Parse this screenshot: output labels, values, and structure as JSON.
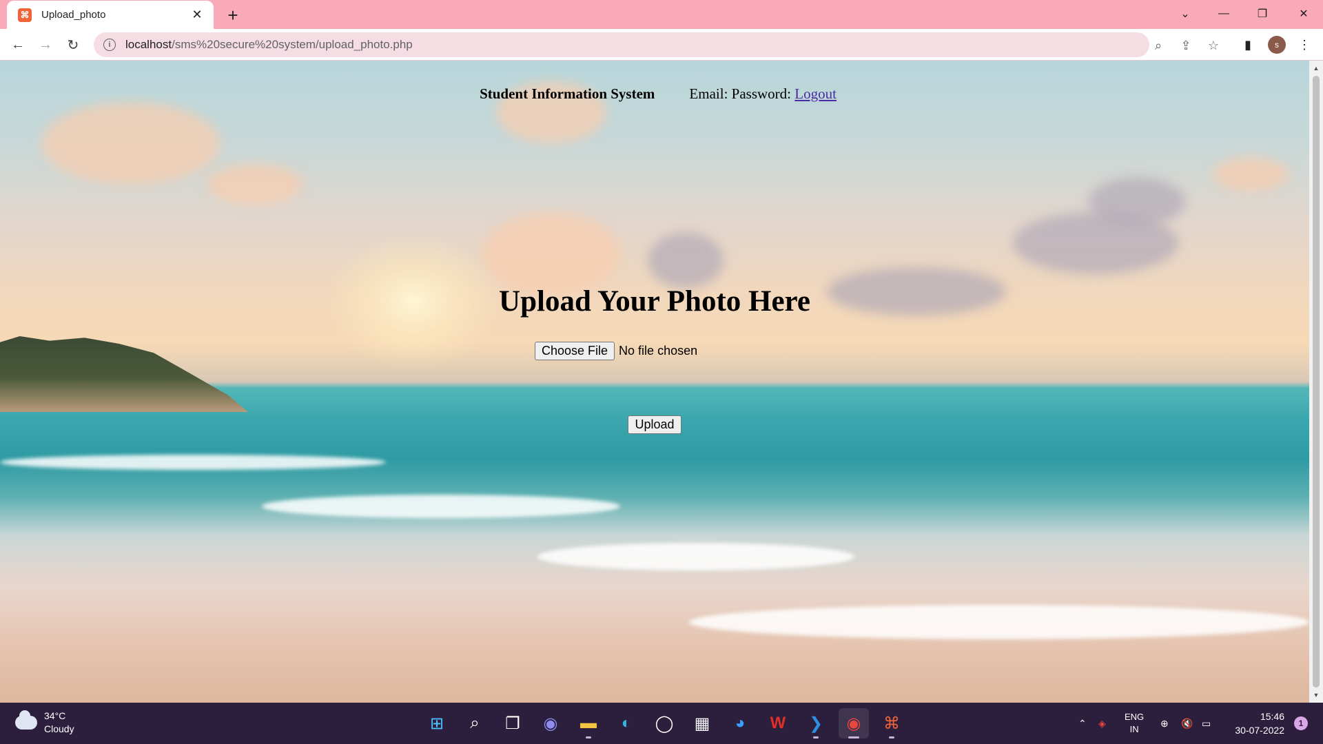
{
  "browser": {
    "tab_title": "Upload_photo",
    "url_host": "localhost",
    "url_path": "/sms%20secure%20system/upload_photo.php",
    "profile_initial": "s"
  },
  "page": {
    "brand": "Student Information System",
    "credentials_text": "Email: Password:",
    "logout_label": "Logout",
    "heading": "Upload Your Photo Here",
    "choose_file_label": "Choose File",
    "file_status": "No file chosen",
    "upload_label": "Upload"
  },
  "taskbar": {
    "temperature": "34°C",
    "weather": "Cloudy",
    "lang_primary": "ENG",
    "lang_secondary": "IN",
    "time": "15:46",
    "date": "30-07-2022",
    "notification_count": "1",
    "apps": [
      "start-icon",
      "search-icon",
      "task-view-icon",
      "chat-icon",
      "file-explorer-icon",
      "edge-icon",
      "github-icon",
      "store-icon",
      "browser-icon",
      "wps-office-icon",
      "vscode-icon",
      "chrome-icon",
      "xampp-icon"
    ]
  },
  "colors": {
    "titlebar": "#f9a9b8",
    "omnibox": "#f6dde3",
    "link": "#4b2aa6",
    "taskbar": "#2b1f3d"
  }
}
